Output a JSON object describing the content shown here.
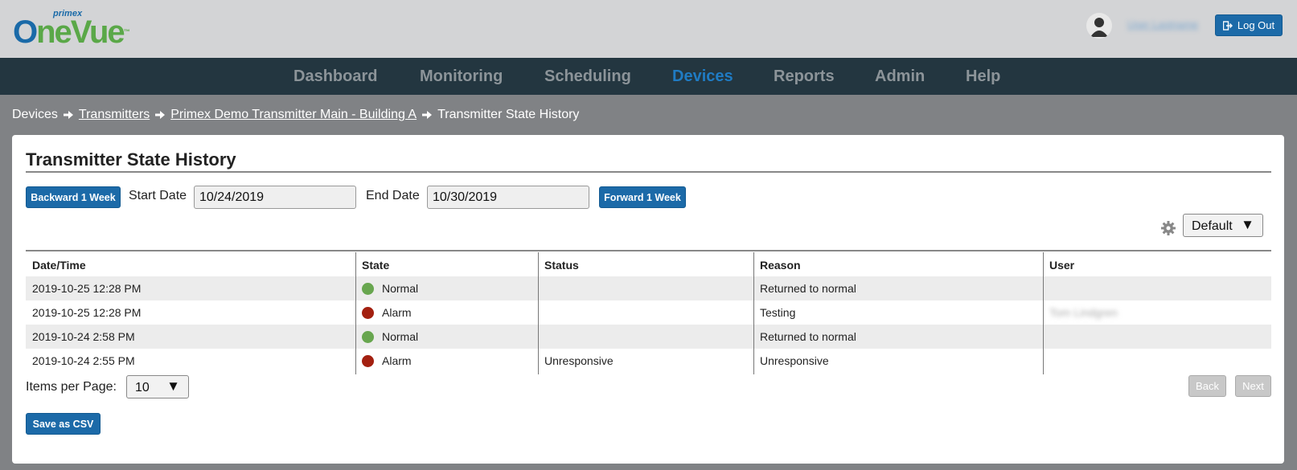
{
  "header": {
    "logo_small": "primex",
    "logo_o": "O",
    "logo_rest": "neVue",
    "logo_tm": "™",
    "user_name": "User Lastname",
    "logout_label": "Log Out"
  },
  "nav": {
    "items": [
      {
        "label": "Dashboard"
      },
      {
        "label": "Monitoring"
      },
      {
        "label": "Scheduling"
      },
      {
        "label": "Devices"
      },
      {
        "label": "Reports"
      },
      {
        "label": "Admin"
      },
      {
        "label": "Help"
      }
    ],
    "active": "Devices"
  },
  "breadcrumb": {
    "root": "Devices",
    "transmitters": "Transmitters",
    "device": "Primex Demo Transmitter Main - Building A",
    "current": "Transmitter State History"
  },
  "panel": {
    "title": "Transmitter State History",
    "backward_label": "Backward 1 Week",
    "start_label": "Start Date",
    "start_value": "10/24/2019",
    "end_label": "End Date",
    "end_value": "10/30/2019",
    "forward_label": "Forward 1 Week",
    "view_select": "Default",
    "caret": "▼"
  },
  "table": {
    "headers": [
      "Date/Time",
      "State",
      "Status",
      "Reason",
      "User"
    ],
    "rows": [
      {
        "datetime": "2019-10-25 12:28 PM",
        "state": "Normal",
        "state_color": "#68a64f",
        "status": "",
        "reason": "Returned to normal",
        "user": ""
      },
      {
        "datetime": "2019-10-25 12:28 PM",
        "state": "Alarm",
        "state_color": "#a32010",
        "status": "",
        "reason": "Testing",
        "user": "Tom Lindgren"
      },
      {
        "datetime": "2019-10-24 2:58 PM",
        "state": "Normal",
        "state_color": "#68a64f",
        "status": "",
        "reason": "Returned to normal",
        "user": ""
      },
      {
        "datetime": "2019-10-24 2:55 PM",
        "state": "Alarm",
        "state_color": "#a32010",
        "status": "Unresponsive",
        "reason": "Unresponsive",
        "user": ""
      }
    ]
  },
  "footer": {
    "items_per_page_label": "Items per Page:",
    "items_per_page_value": "10",
    "back_label": "Back",
    "next_label": "Next",
    "csv_label": "Save as CSV"
  },
  "colors": {
    "accent": "#1c6aa8",
    "nav_bg": "#233640",
    "nav_active": "#1f7bc3",
    "normal": "#68a64f",
    "alarm": "#a32010"
  },
  "icons": [
    "logout-icon",
    "user-avatar-icon",
    "arrow-right-icon",
    "gear-icon",
    "chevron-down-icon",
    "status-dot-icon"
  ]
}
